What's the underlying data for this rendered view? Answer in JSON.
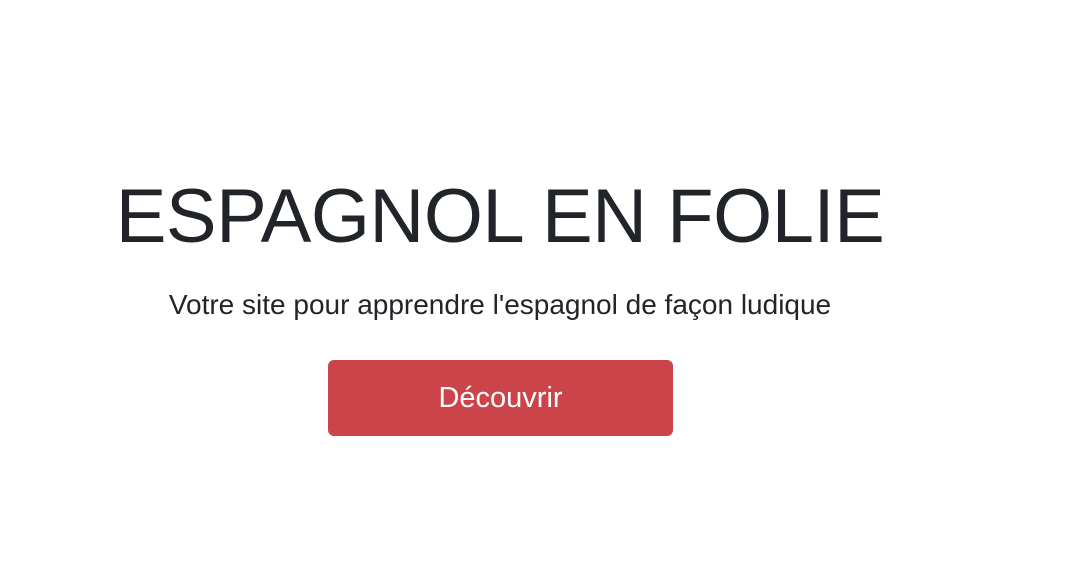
{
  "hero": {
    "title": "ESPAGNOL EN FOLIE",
    "subtitle": "Votre site pour apprendre l'espagnol de façon ludique",
    "cta_label": "Découvrir"
  },
  "colors": {
    "background": "#ffffff",
    "text": "#212529",
    "button_background": "#cb444a",
    "button_text": "#ffffff"
  }
}
